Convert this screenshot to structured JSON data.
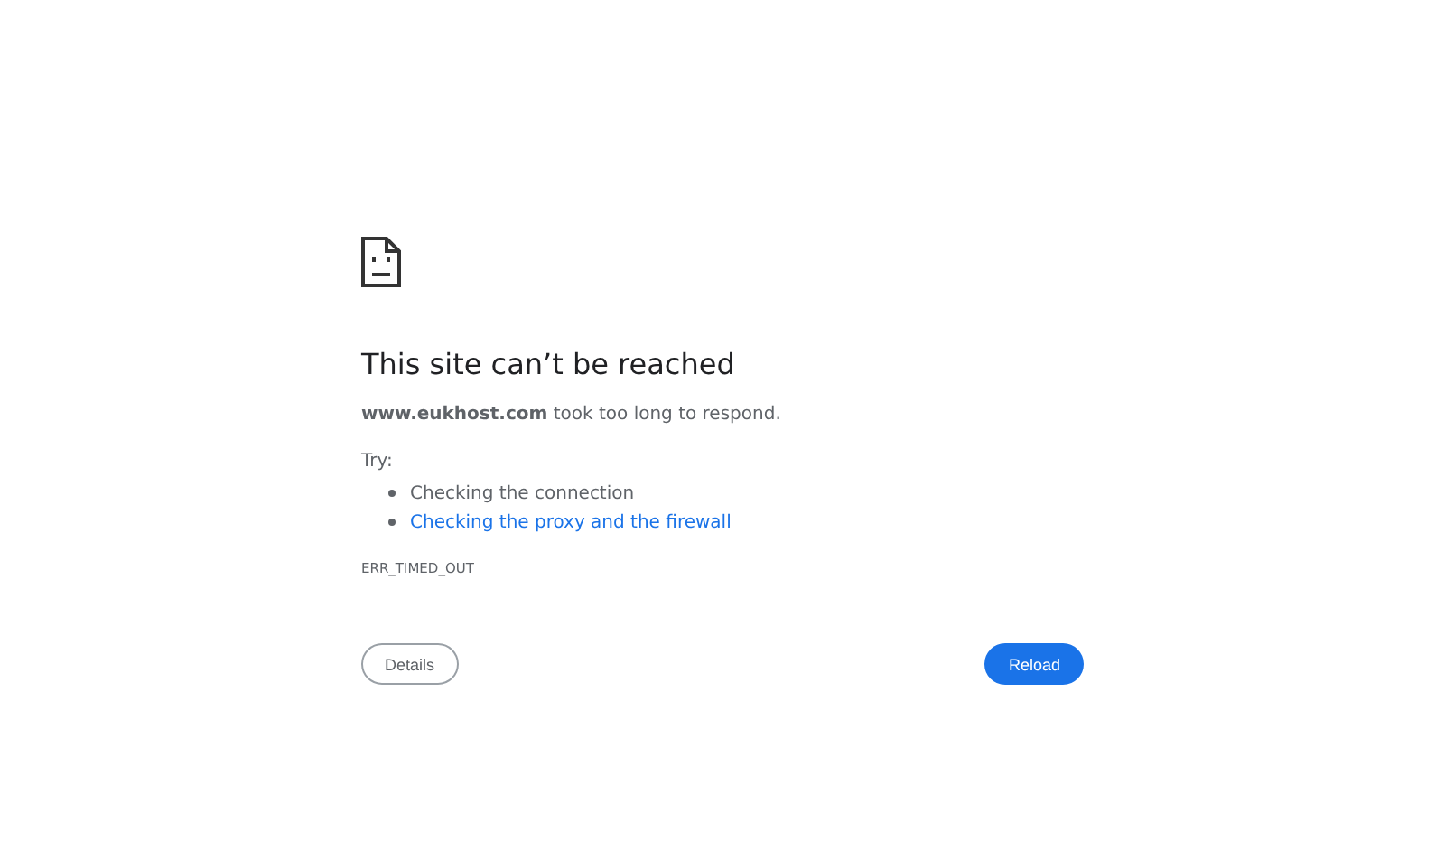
{
  "heading": "This site can’t be reached",
  "message": "**www.eukhost.com** took too long to respond.",
  "try_label": "Try:",
  "suggestions": [
    {
      "kind": "text",
      "text": "Checking the connection"
    },
    {
      "kind": "link",
      "text": "Checking the proxy and the firewall"
    }
  ],
  "error_code": "ERR_TIMED_OUT",
  "buttons": [
    {
      "kind": "secondary",
      "label": "Details"
    },
    {
      "kind": "primary",
      "label": "Reload"
    }
  ]
}
